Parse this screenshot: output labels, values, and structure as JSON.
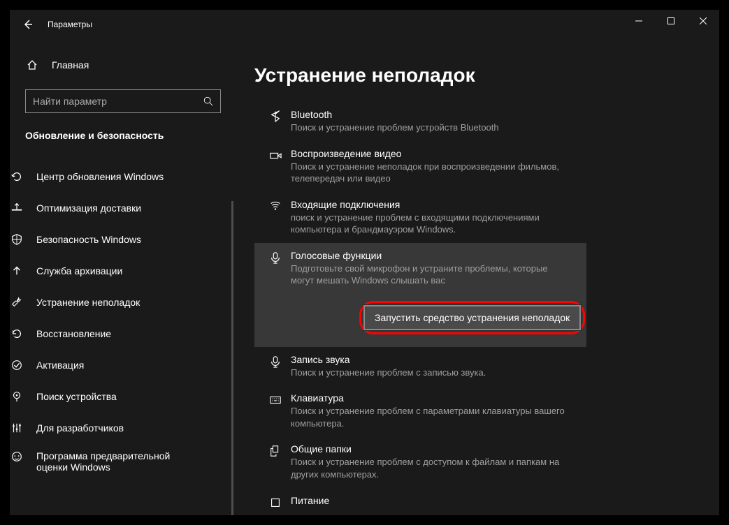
{
  "title": "Параметры",
  "home_label": "Главная",
  "search": {
    "placeholder": "Найти параметр"
  },
  "section_heading": "Обновление и безопасность",
  "nav": [
    {
      "label": "Центр обновления Windows",
      "icon": "refresh"
    },
    {
      "label": "Оптимизация доставки",
      "icon": "delivery"
    },
    {
      "label": "Безопасность Windows",
      "icon": "shield"
    },
    {
      "label": "Служба архивации",
      "icon": "arrow-up"
    },
    {
      "label": "Устранение неполадок",
      "icon": "wrench"
    },
    {
      "label": "Восстановление",
      "icon": "history"
    },
    {
      "label": "Активация",
      "icon": "check-circle"
    },
    {
      "label": "Поиск устройства",
      "icon": "location"
    },
    {
      "label": "Для разработчиков",
      "icon": "sliders"
    },
    {
      "label": "Программа предварительной оценки Windows",
      "icon": "insider"
    }
  ],
  "main": {
    "heading": "Устранение неполадок",
    "items": [
      {
        "title": "Bluetooth",
        "desc": "Поиск и устранение проблем устройств Bluetooth",
        "icon": "bluetooth"
      },
      {
        "title": "Воспроизведение видео",
        "desc": "Поиск и устранение неполадок при воспроизведении фильмов, телепередач или видео",
        "icon": "video"
      },
      {
        "title": "Входящие подключения",
        "desc": "поиск и устранение проблем с входящими подключениями компьютера и брандмауэром Windows.",
        "icon": "wifi"
      },
      {
        "title": "Голосовые функции",
        "desc": "Подготовьте свой микрофон и устраните проблемы, которые могут мешать Windows слышать вас",
        "icon": "mic",
        "selected": true,
        "button": "Запустить средство устранения неполадок"
      },
      {
        "title": "Запись звука",
        "desc": "Поиск и устранение проблем с записью звука.",
        "icon": "mic"
      },
      {
        "title": "Клавиатура",
        "desc": "Поиск и устранение проблем с параметрами клавиатуры вашего компьютера.",
        "icon": "keyboard"
      },
      {
        "title": "Общие папки",
        "desc": "Поиск и устранение проблем с доступом к файлам и папкам на других компьютерах.",
        "icon": "share"
      },
      {
        "title": "Питание",
        "desc": "",
        "icon": "power"
      }
    ]
  }
}
